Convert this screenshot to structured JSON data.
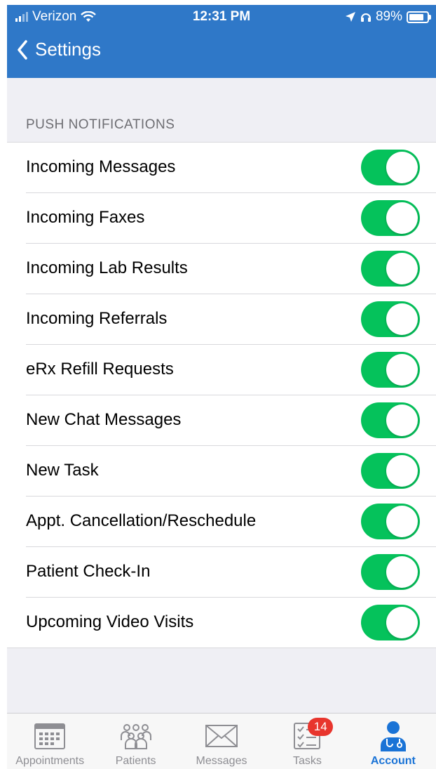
{
  "status_bar": {
    "carrier": "Verizon",
    "time": "12:31 PM",
    "battery": "89%"
  },
  "header": {
    "back_label": "Settings"
  },
  "section": {
    "title": "PUSH NOTIFICATIONS"
  },
  "settings": [
    {
      "label": "Incoming Messages",
      "enabled": true
    },
    {
      "label": "Incoming Faxes",
      "enabled": true
    },
    {
      "label": "Incoming Lab Results",
      "enabled": true
    },
    {
      "label": "Incoming Referrals",
      "enabled": true
    },
    {
      "label": "eRx Refill Requests",
      "enabled": true
    },
    {
      "label": "New Chat Messages",
      "enabled": true
    },
    {
      "label": "New Task",
      "enabled": true
    },
    {
      "label": "Appt. Cancellation/Reschedule",
      "enabled": true
    },
    {
      "label": "Patient Check-In",
      "enabled": true
    },
    {
      "label": "Upcoming Video Visits",
      "enabled": true
    }
  ],
  "tabs": [
    {
      "label": "Appointments",
      "icon": "calendar-icon"
    },
    {
      "label": "Patients",
      "icon": "people-icon"
    },
    {
      "label": "Messages",
      "icon": "envelope-icon"
    },
    {
      "label": "Tasks",
      "icon": "checklist-icon",
      "badge": "14"
    },
    {
      "label": "Account",
      "icon": "doctor-icon",
      "active": true
    }
  ],
  "colors": {
    "header": "#2f78c8",
    "toggle_on": "#05c25b",
    "active_tab": "#1a73d6",
    "badge": "#e8352d"
  }
}
